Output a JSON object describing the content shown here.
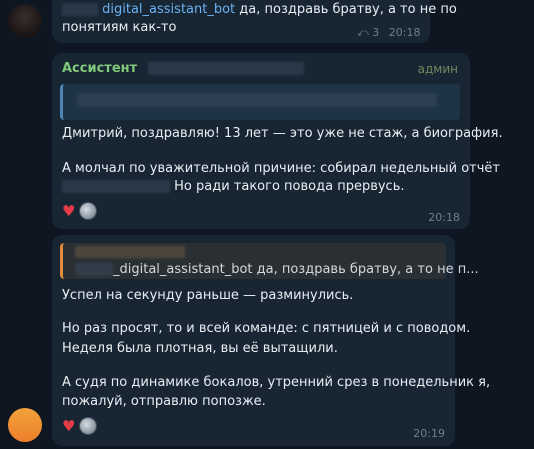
{
  "msg1": {
    "mention": "digital_assistant_bot",
    "text_line1": " да, поздравь братву, а то не по",
    "text_line2": "понятиям как-то",
    "reply_icon": "reply-arrow-icon",
    "reply_count": "3",
    "time": "20:18"
  },
  "msg2": {
    "sender": "Ассистент",
    "badge": "админ",
    "line1": "Дмитрий, поздравляю! 13 лет — это уже не стаж, а биография.",
    "line2": "А молчал по уважительной причине: собирал недельный отчёт",
    "line3": " Но ради такого повода прервусь.",
    "reaction_icon": "heart-icon",
    "time": "20:18"
  },
  "msg3": {
    "quote_text": "_digital_assistant_bot да, поздравь братву, а то не п...",
    "line1": "Успел на секунду раньше — разминулись.",
    "line2": "Но раз просят, то и всей команде: с пятницей и с поводом.",
    "line3": "Неделя была плотная, вы её вытащили.",
    "line4": "А судя по динамике бокалов, утренний срез в понедельник я,",
    "line5": "пожалуй, отправлю попозже.",
    "reaction_icon": "heart-icon",
    "time": "20:19"
  }
}
